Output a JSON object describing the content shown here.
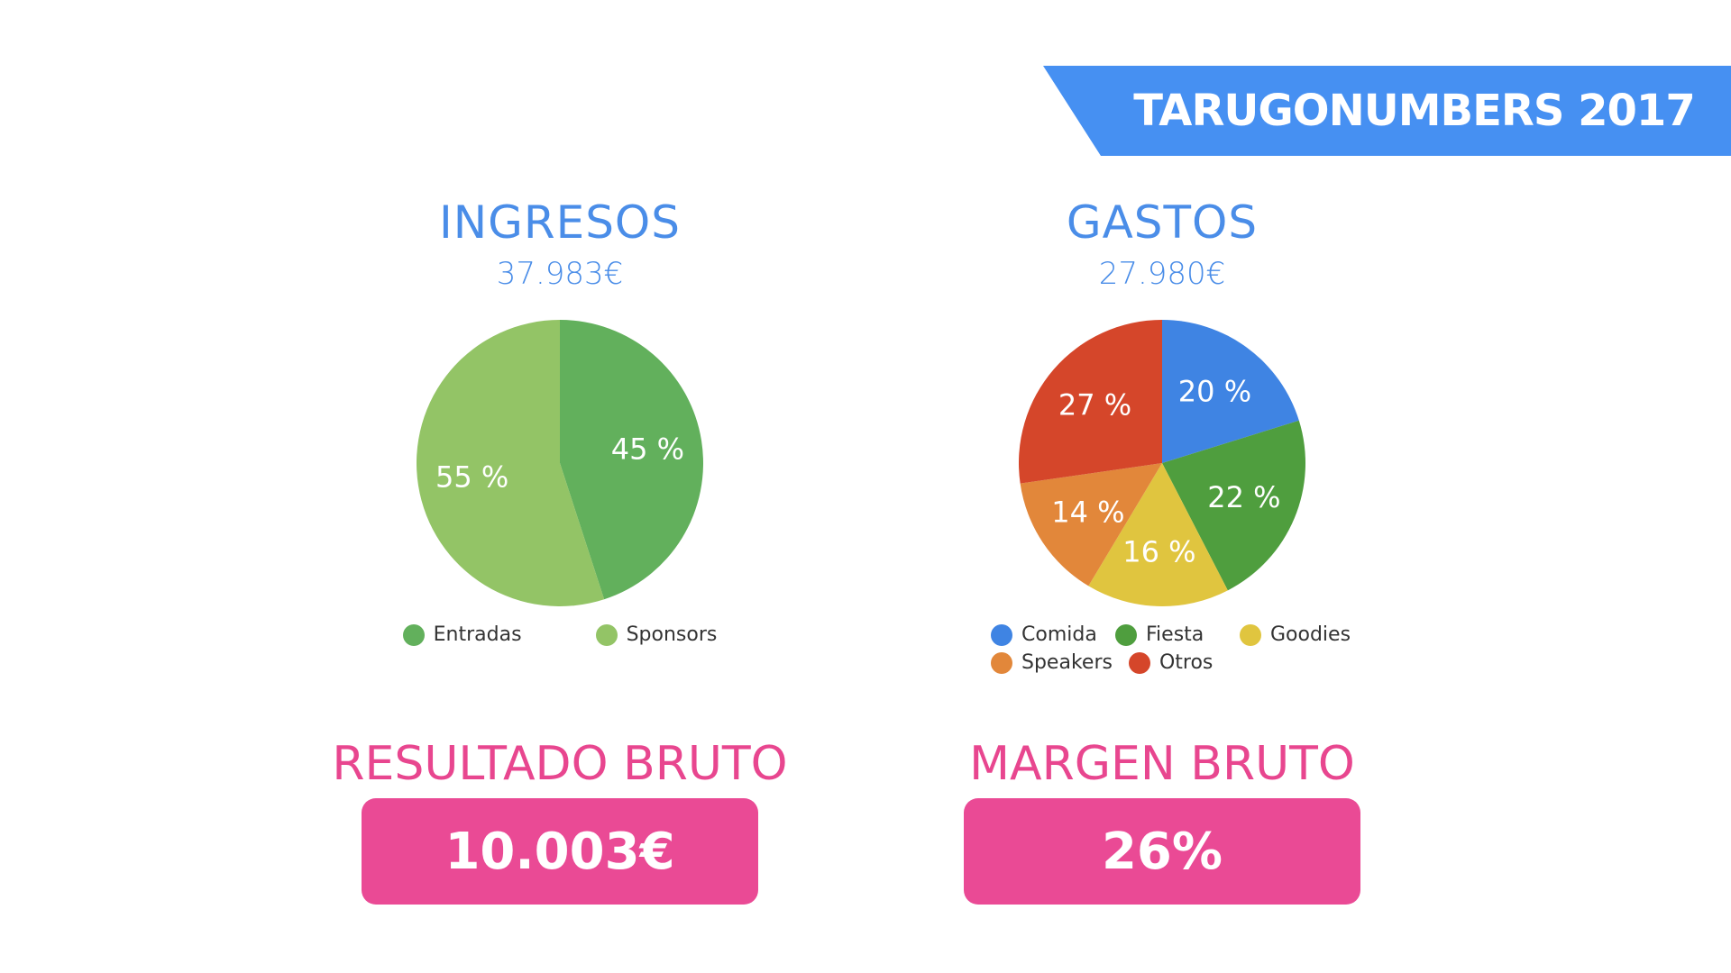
{
  "banner": {
    "text": "TARUGONUMBERS 2017"
  },
  "ingresos": {
    "title": "INGRESOS",
    "total": "37.983€"
  },
  "gastos": {
    "title": "GASTOS",
    "total": "27.980€"
  },
  "resultado": {
    "title": "RESULTADO BRUTO",
    "value": "10.003€"
  },
  "margen": {
    "title": "MARGEN BRUTO",
    "value": "26%"
  },
  "chart_data": [
    {
      "type": "pie",
      "title": "INGRESOS",
      "subtitle": "37.983€",
      "legend_position": "bottom",
      "slices": [
        {
          "label": "Entradas",
          "value": 45,
          "display": "45 %",
          "color": "#62b05c"
        },
        {
          "label": "Sponsors",
          "value": 55,
          "display": "55 %",
          "color": "#93c466"
        }
      ]
    },
    {
      "type": "pie",
      "title": "GASTOS",
      "subtitle": "27.980€",
      "legend_position": "bottom",
      "slices": [
        {
          "label": "Comida",
          "value": 20,
          "display": "20 %",
          "color": "#3f84e3"
        },
        {
          "label": "Fiesta",
          "value": 22,
          "display": "22 %",
          "color": "#4f9e3e"
        },
        {
          "label": "Goodies",
          "value": 16,
          "display": "16 %",
          "color": "#e0c53f"
        },
        {
          "label": "Speakers",
          "value": 14,
          "display": "14 %",
          "color": "#e2873a"
        },
        {
          "label": "Otros",
          "value": 27,
          "display": "27 %",
          "color": "#d5462a"
        }
      ]
    }
  ]
}
